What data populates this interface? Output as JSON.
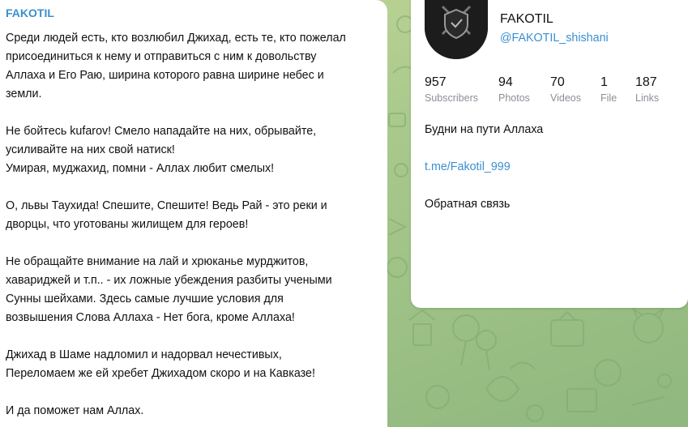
{
  "message": {
    "author": "FAKOTIL",
    "paragraphs": [
      [
        "Среди людей есть, кто возлюбил Джихад, есть те, кто пожелал",
        "присоединиться к нему и отправиться с ним к довольству",
        "Аллаха и Его Раю, ширина которого равна ширине небес и",
        "земли."
      ],
      [
        "Не бойтесь kufarov! Смело нападайте на них, обрывайте,",
        "усиливайте на них свой натиск!",
        "Умирая, муджахид, помни - Аллах любит смелых!"
      ],
      [
        "О, львы Таухида! Спешите, Спешите! Ведь Рай - это реки и",
        "дворцы, что уготованы жилищем для героев!"
      ],
      [
        "Не обращайте внимание на лай и хрюканье мурджитов,",
        "хавариджей и т.п.. - их ложные убеждения разбиты учеными",
        "Сунны шейхами. Здесь самые лучшие условия для",
        "возвышения Слова Аллаха - Нет бога, кроме Аллаха!"
      ],
      [
        "Джихад в Шаме надломил и надорвал нечестивых,",
        "Переломаем же ей хребет Джихадом скоро и на Кавказе!"
      ],
      [
        "И да поможет нам Аллах."
      ]
    ]
  },
  "channel": {
    "name": "FAKOTIL",
    "handle": "@FAKOTIL_shishani",
    "stats": [
      {
        "value": "957",
        "label": "Subscribers"
      },
      {
        "value": "94",
        "label": "Photos"
      },
      {
        "value": "70",
        "label": "Videos"
      },
      {
        "value": "1",
        "label": "File"
      },
      {
        "value": "187",
        "label": "Links"
      }
    ],
    "description": "Будни на пути Аллаха",
    "link": "t.me/Fakotil_999",
    "feedback": "Обратная связь"
  },
  "colors": {
    "accent": "#3a8fd0",
    "background": "#9cbf85",
    "muted": "#8a8f95"
  }
}
